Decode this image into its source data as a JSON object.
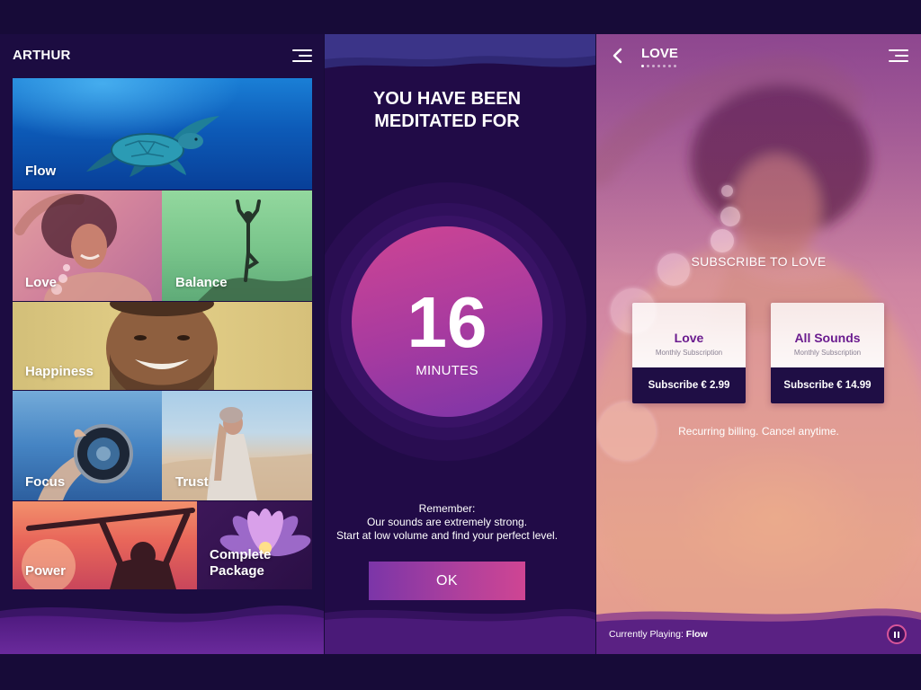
{
  "theme": {
    "page_bg": "#170b38",
    "menu_panel_bg": "#1c0c41",
    "meditation_panel_bg": "#210b47",
    "accent_pink": "#cf4593",
    "accent_purple": "#7b35a8",
    "plan_button_bg": "#1f0e45",
    "plan_title_color": "#6b1c8f",
    "plan_subtitle_color": "#8a8194"
  },
  "menu_screen": {
    "user_name": "ARTHUR",
    "menu_icon": "hamburger-menu-icon",
    "tiles": [
      {
        "label": "Flow"
      },
      {
        "label": "Love"
      },
      {
        "label": "Balance"
      },
      {
        "label": "Happiness"
      },
      {
        "label": "Focus"
      },
      {
        "label": "Trust"
      },
      {
        "label": "Power"
      },
      {
        "label": "Complete Package"
      }
    ]
  },
  "meditation_screen": {
    "title_line1": "YOU HAVE BEEN",
    "title_line2": "MEDITATED FOR",
    "duration_value": "16",
    "duration_unit": "MINUTES",
    "remember_heading": "Remember:",
    "remember_line1": "Our sounds are extremely strong.",
    "remember_line2": "Start at low volume and find your perfect level.",
    "ok_label": "OK"
  },
  "subscribe_screen": {
    "back_icon": "chevron-left-icon",
    "title": "LOVE",
    "page_indicator": {
      "total": 7,
      "active_index": 0
    },
    "menu_icon": "hamburger-menu-icon",
    "heading": "SUBSCRIBE TO LOVE",
    "plans": [
      {
        "name": "Love",
        "period": "Monthly Subscription",
        "cta": "Subscribe € 2.99"
      },
      {
        "name": "All Sounds",
        "period": "Monthly Subscription",
        "cta": "Subscribe € 14.99"
      }
    ],
    "billing_note": "Recurring billing. Cancel anytime.",
    "now_playing": {
      "label": "Currently Playing:",
      "track": "Flow",
      "control_icon": "pause-icon"
    }
  }
}
